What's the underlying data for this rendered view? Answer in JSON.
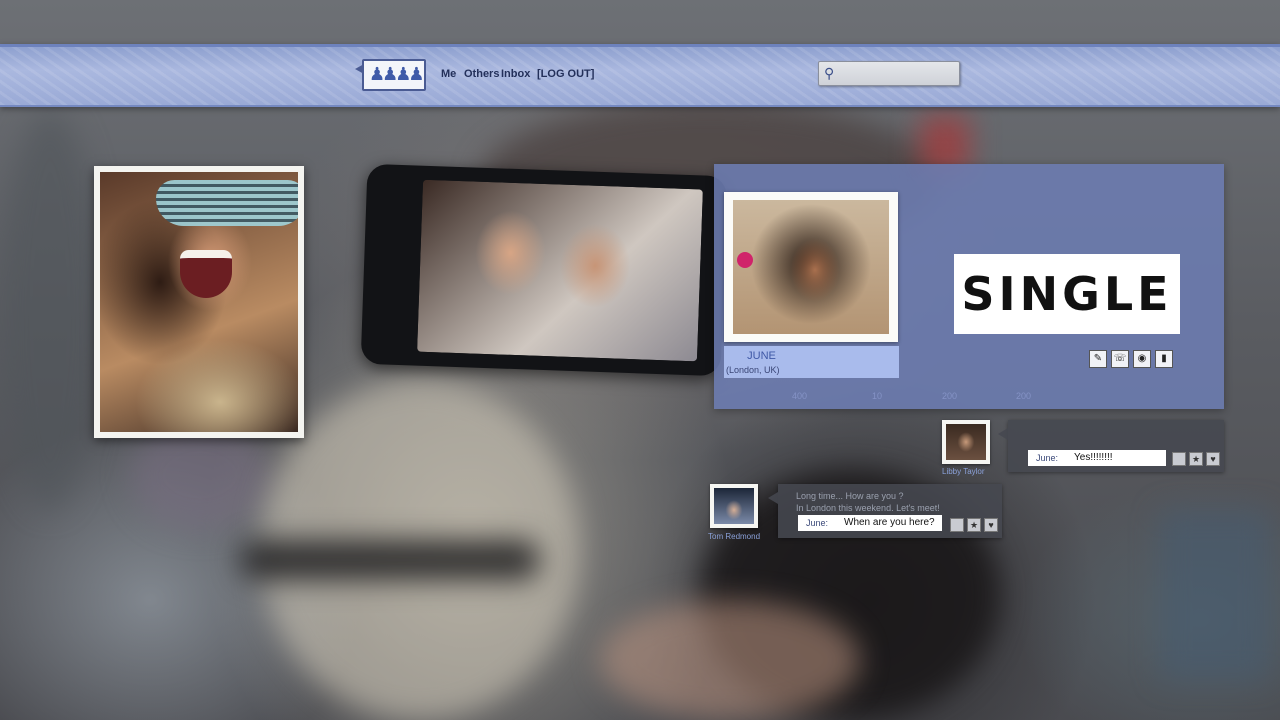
{
  "nav": {
    "items": [
      "Me",
      "Others",
      "Inbox",
      "[LOG OUT]"
    ]
  },
  "search": {
    "placeholder": ""
  },
  "icons": {
    "logo": "people-icon",
    "search": "search-icon"
  },
  "profile": {
    "name": "JUNE",
    "location": "(London, UK)",
    "status": "SINGLE",
    "stats": [
      "400",
      "10",
      "200",
      "200"
    ],
    "tools": [
      "edit-icon",
      "phone-icon",
      "camera-icon",
      "mobile-icon"
    ]
  },
  "chats": [
    {
      "friend": "Libby Taylor",
      "message": "",
      "reply_who": "June:",
      "reply_text": "Yes!!!!!!!!"
    },
    {
      "friend": "Tom Redmond",
      "message_line1": "Long time... How are you ?",
      "message_line2": "In London this weekend. Let's meet!",
      "reply_who": "June:",
      "reply_text": "When are you here?"
    }
  ],
  "colors": {
    "bar": "#9aaad6",
    "panel": "#6c7cb2",
    "accent": "#3f58a6"
  }
}
